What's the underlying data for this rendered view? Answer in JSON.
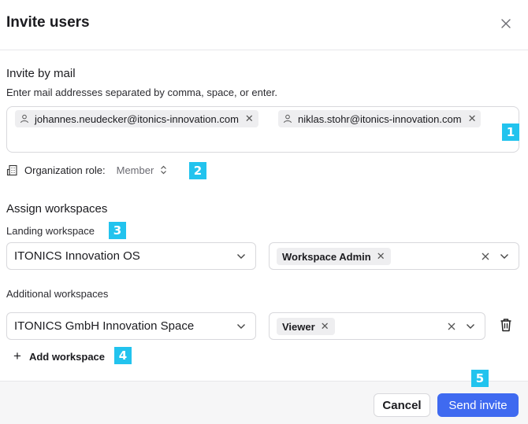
{
  "dialog": {
    "title": "Invite users"
  },
  "invite": {
    "heading": "Invite by mail",
    "hint": "Enter mail addresses separated by comma, space, or enter.",
    "emails": [
      "johannes.neudecker@itonics-innovation.com",
      "niklas.stohr@itonics-innovation.com"
    ]
  },
  "role": {
    "label": "Organization role:",
    "value": "Member"
  },
  "workspaces": {
    "heading": "Assign workspaces",
    "landing_label": "Landing workspace",
    "landing_value": "ITONICS Innovation OS",
    "landing_role": "Workspace Admin",
    "additional_label": "Additional workspaces",
    "additional_value": "ITONICS GmbH Innovation Space",
    "additional_role": "Viewer",
    "add_label": "Add workspace"
  },
  "footer": {
    "cancel": "Cancel",
    "send": "Send invite"
  },
  "badges": [
    "1",
    "2",
    "3",
    "4",
    "5"
  ],
  "colors": {
    "primary": "#3f6af0",
    "badge": "#22c3ee"
  }
}
